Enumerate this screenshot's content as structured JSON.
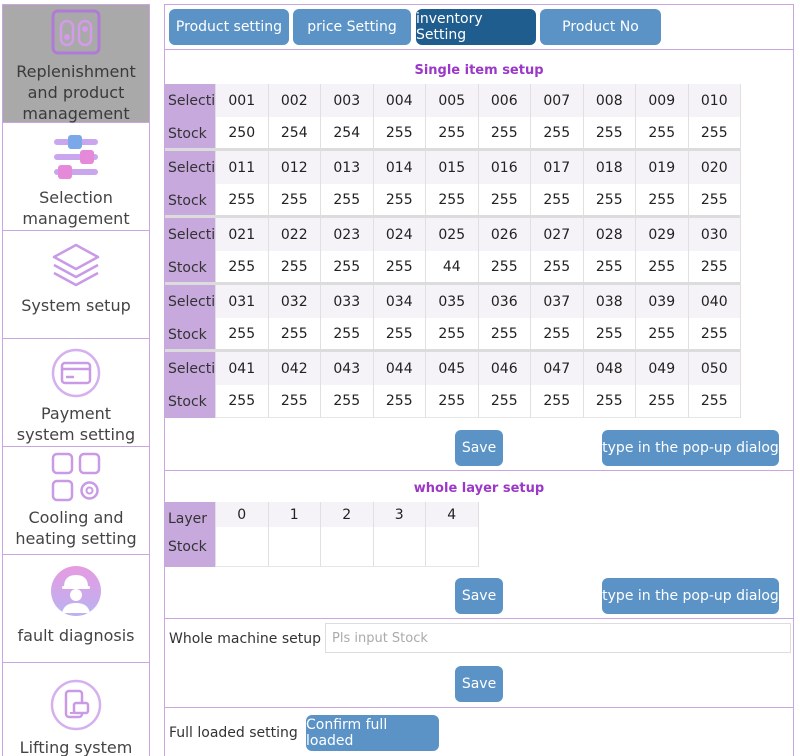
{
  "sidebar": {
    "items": [
      {
        "label": "Replenishment and product management",
        "icon": "replenishment-icon",
        "active": true
      },
      {
        "label": "Selection management",
        "icon": "sliders-icon",
        "active": false
      },
      {
        "label": "System setup",
        "icon": "layers-icon",
        "active": false
      },
      {
        "label": "Payment system setting",
        "icon": "payment-card-icon",
        "active": false
      },
      {
        "label": "Cooling and heating setting",
        "icon": "apps-gear-icon",
        "active": false
      },
      {
        "label": "fault diagnosis",
        "icon": "engineer-icon",
        "active": false
      },
      {
        "label": "Lifting system",
        "icon": "lifting-icon",
        "active": false
      }
    ]
  },
  "tabs": [
    {
      "label": "Product setting",
      "active": false
    },
    {
      "label": "price Setting",
      "active": false
    },
    {
      "label": "inventory Setting",
      "active": true
    },
    {
      "label": "Product No",
      "active": false
    }
  ],
  "single_item": {
    "title": "Single item setup",
    "row_header_selection": "Selecti",
    "row_header_stock": "Stock",
    "groups": [
      {
        "selections": [
          "001",
          "002",
          "003",
          "004",
          "005",
          "006",
          "007",
          "008",
          "009",
          "010"
        ],
        "stocks": [
          "250",
          "254",
          "254",
          "255",
          "255",
          "255",
          "255",
          "255",
          "255",
          "255"
        ]
      },
      {
        "selections": [
          "011",
          "012",
          "013",
          "014",
          "015",
          "016",
          "017",
          "018",
          "019",
          "020"
        ],
        "stocks": [
          "255",
          "255",
          "255",
          "255",
          "255",
          "255",
          "255",
          "255",
          "255",
          "255"
        ]
      },
      {
        "selections": [
          "021",
          "022",
          "023",
          "024",
          "025",
          "026",
          "027",
          "028",
          "029",
          "030"
        ],
        "stocks": [
          "255",
          "255",
          "255",
          "255",
          "44",
          "255",
          "255",
          "255",
          "255",
          "255"
        ]
      },
      {
        "selections": [
          "031",
          "032",
          "033",
          "034",
          "035",
          "036",
          "037",
          "038",
          "039",
          "040"
        ],
        "stocks": [
          "255",
          "255",
          "255",
          "255",
          "255",
          "255",
          "255",
          "255",
          "255",
          "255"
        ]
      },
      {
        "selections": [
          "041",
          "042",
          "043",
          "044",
          "045",
          "046",
          "047",
          "048",
          "049",
          "050"
        ],
        "stocks": [
          "255",
          "255",
          "255",
          "255",
          "255",
          "255",
          "255",
          "255",
          "255",
          "255"
        ]
      }
    ],
    "save_label": "Save",
    "popup_label": "type in the pop-up dialog"
  },
  "whole_layer": {
    "title": "whole layer setup",
    "row_header_layer": "Layer",
    "row_header_stock": "Stock",
    "layers": [
      "0",
      "1",
      "2",
      "3",
      "4"
    ],
    "stocks": [
      "",
      "",
      "",
      "",
      ""
    ],
    "save_label": "Save",
    "popup_label": "type in the pop-up dialog"
  },
  "whole_machine": {
    "label": "Whole machine setup",
    "placeholder": "Pls input Stock",
    "value": "",
    "save_label": "Save"
  },
  "full_loaded": {
    "label": "Full loaded setting",
    "button_label": "Confirm full loaded"
  },
  "colors": {
    "accent": "#5b93c7",
    "accent_active": "#1f5d8f",
    "section_title": "#9b38c8",
    "row_header": "#c7a9dd",
    "border": "#c9a6e0"
  }
}
